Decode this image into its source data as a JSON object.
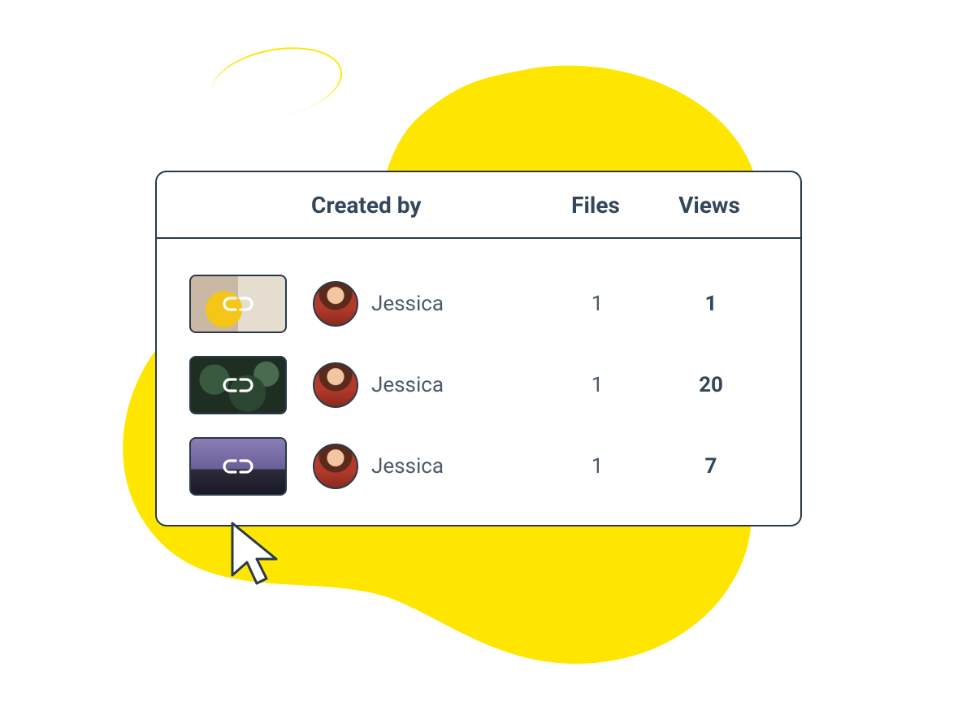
{
  "colors": {
    "accent_yellow": "#ffe600",
    "panel_border": "#2a3a4a",
    "text_heading": "#33475b",
    "text_body": "#4a5a6a"
  },
  "table": {
    "headers": {
      "created_by": "Created by",
      "files": "Files",
      "views": "Views"
    },
    "rows": [
      {
        "thumb_variant": "chair",
        "creator": "Jessica",
        "files": "1",
        "views": "1"
      },
      {
        "thumb_variant": "leaves",
        "creator": "Jessica",
        "files": "1",
        "views": "20"
      },
      {
        "thumb_variant": "mountain",
        "creator": "Jessica",
        "files": "1",
        "views": "7"
      }
    ]
  }
}
